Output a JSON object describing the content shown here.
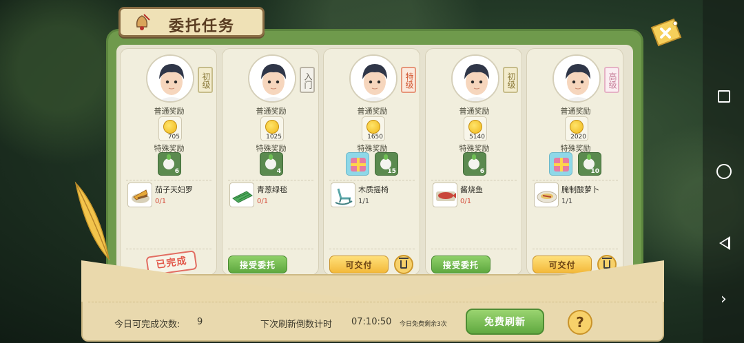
{
  "title": "委托任务",
  "reward_labels": {
    "normal": "普通奖励",
    "special": "特殊奖励"
  },
  "cards": [
    {
      "grade": "初级",
      "coins": "705",
      "special": [
        {
          "type": "radish",
          "count": "6"
        }
      ],
      "task_name": "茄子天妇罗",
      "progress": "0/1",
      "action": "已完成",
      "state": "done"
    },
    {
      "grade": "入门",
      "coins": "1025",
      "special": [
        {
          "type": "radish",
          "count": "4"
        }
      ],
      "task_name": "青葱绿毯",
      "progress": "0/1",
      "action": "接受委托",
      "state": "accept"
    },
    {
      "grade": "特级",
      "coins": "1650",
      "special": [
        {
          "type": "gift",
          "count": ""
        },
        {
          "type": "radish",
          "count": "15"
        }
      ],
      "task_name": "木质摇椅",
      "progress": "1/1",
      "action": "可交付",
      "state": "deliver"
    },
    {
      "grade": "初级",
      "coins": "5140",
      "special": [
        {
          "type": "radish",
          "count": "6"
        }
      ],
      "task_name": "酱烧鱼",
      "progress": "0/1",
      "action": "接受委托",
      "state": "accept"
    },
    {
      "grade": "高级",
      "coins": "2020",
      "special": [
        {
          "type": "gift",
          "count": ""
        },
        {
          "type": "radish",
          "count": "10"
        }
      ],
      "task_name": "腌制酸萝卜",
      "progress": "1/1",
      "action": "可交付",
      "state": "deliver"
    }
  ],
  "footer": {
    "daily_label": "今日可完成次数:",
    "daily_count": "9",
    "countdown_label": "下次刷新倒数计时",
    "countdown_value": "07:10:50",
    "free_note": "今日免费剩余3次",
    "refresh_button": "免费刷新",
    "help": "?"
  },
  "colors": {
    "panel_green": "#6f9a4c",
    "button_green": "#60a940",
    "button_yellow": "#f3b93a",
    "stamp_red": "#e2594c"
  }
}
